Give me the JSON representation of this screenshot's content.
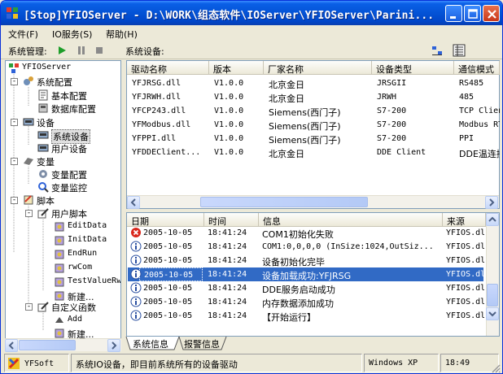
{
  "window": {
    "title": "[Stop]YFIOServer - D:\\WORK\\组态软件\\IOServer\\YFIOServer\\Parini..."
  },
  "menu": [
    "文件(F)",
    "IO服务(S)",
    "帮助(H)"
  ],
  "toolbar": {
    "system_label": "系统管理:",
    "device_label": "系统设备:"
  },
  "tree": {
    "root": "YFIOServer",
    "items": [
      {
        "label": "系统配置",
        "icon": "gear-icon"
      },
      {
        "label": "基本配置",
        "icon": "document-icon"
      },
      {
        "label": "数据库配置",
        "icon": "database-icon"
      },
      {
        "label": "设备",
        "icon": "device-icon"
      },
      {
        "label": "系统设备",
        "icon": "device-icon"
      },
      {
        "label": "用户设备",
        "icon": "device-icon"
      },
      {
        "label": "变量",
        "icon": "variable-icon"
      },
      {
        "label": "变量配置",
        "icon": "gear-icon"
      },
      {
        "label": "变量监控",
        "icon": "monitor-icon"
      },
      {
        "label": "脚本",
        "icon": "script-icon"
      },
      {
        "label": "用户脚本",
        "icon": "pencil-icon"
      },
      {
        "label": "EditData",
        "icon": "script-file-icon"
      },
      {
        "label": "InitData",
        "icon": "script-file-icon"
      },
      {
        "label": "EndRun",
        "icon": "script-file-icon"
      },
      {
        "label": "rwCom",
        "icon": "script-file-icon"
      },
      {
        "label": "TestValueRw",
        "icon": "script-file-icon"
      },
      {
        "label": "新建...",
        "icon": "script-file-icon"
      },
      {
        "label": "自定义函数",
        "icon": "pencil-icon"
      },
      {
        "label": "Add",
        "icon": "function-icon"
      },
      {
        "label": "新建...",
        "icon": "script-file-icon"
      }
    ]
  },
  "drivers": {
    "columns": [
      "驱动名称",
      "版本",
      "厂家名称",
      "设备类型",
      "通信模式"
    ],
    "rows": [
      [
        "YFJRSG.dll",
        "V1.0.0",
        "北京金日",
        "JRSGII",
        "RS485"
      ],
      [
        "YFJRWH.dll",
        "V1.0.0",
        "北京金日",
        "JRWH",
        "485"
      ],
      [
        "YFCP243.dll",
        "V1.0.0",
        "Siemens(西门子)",
        "S7-200",
        "TCP Client"
      ],
      [
        "YFModbus.dll",
        "V1.0.0",
        "Siemens(西门子)",
        "S7-200",
        "Modbus RTU"
      ],
      [
        "YFPPI.dll",
        "V1.0.0",
        "Siemens(西门子)",
        "S7-200",
        "PPI"
      ],
      [
        "YFDDEClient...",
        "V1.0.0",
        "北京金日",
        "DDE Client",
        "DDE温连接"
      ]
    ]
  },
  "log": {
    "columns": [
      "日期",
      "时间",
      "信息",
      "来源"
    ],
    "rows": [
      {
        "type": "error",
        "date": "2005-10-05",
        "time": "18:41:24",
        "info": "COM1初始化失败",
        "source": "YFIOS.dll"
      },
      {
        "type": "info",
        "date": "2005-10-05",
        "time": "18:41:24",
        "info": "COM1:0,0,0,0 (InSize:1024,OutSiz...",
        "source": "YFIOS.dll"
      },
      {
        "type": "info",
        "date": "2005-10-05",
        "time": "18:41:24",
        "info": "设备初始化完毕",
        "source": "YFIOS.dll"
      },
      {
        "type": "info",
        "date": "2005-10-05",
        "time": "18:41:24",
        "info": "设备加载成功:YFJRSG",
        "source": "YFIOS.dll"
      },
      {
        "type": "info",
        "date": "2005-10-05",
        "time": "18:41:24",
        "info": "DDE服务启动成功",
        "source": "YFIOS.dll"
      },
      {
        "type": "info",
        "date": "2005-10-05",
        "time": "18:41:24",
        "info": "内存数据添加成功",
        "source": "YFIOS.dll"
      },
      {
        "type": "info",
        "date": "2005-10-05",
        "time": "18:41:24",
        "info": "【开始运行】",
        "source": "YFIOS.dll"
      }
    ]
  },
  "tabs": [
    "系统信息",
    "报警信息"
  ],
  "status": {
    "app": "YFSoft",
    "message": "系统IO设备，即目前系统所有的设备驱动",
    "os": "Windows XP",
    "time": "18:49"
  },
  "colors": {
    "title_blue": "#0453D6",
    "selection": "#316AC5",
    "face": "#ECE9D8"
  }
}
